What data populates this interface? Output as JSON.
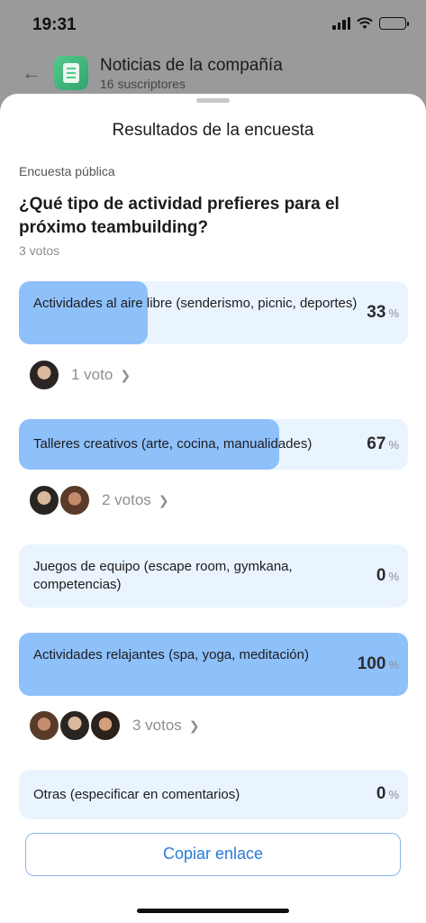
{
  "status_bar": {
    "time": "19:31"
  },
  "chat_header": {
    "title": "Noticias de la compañía",
    "subtitle": "16 suscriptores"
  },
  "sheet": {
    "title": "Resultados de la encuesta",
    "poll_type": "Encuesta pública",
    "question": "¿Qué tipo de actividad prefieres para el próximo teambuilding?",
    "total_votes": "3 votos",
    "copy_link": "Copiar enlace"
  },
  "options": [
    {
      "label": "Actividades al aire libre (senderismo, picnic, deportes)",
      "percent": "33",
      "fill": 0.33,
      "voters": "1 voto",
      "avatars": 1
    },
    {
      "label": "Talleres creativos (arte, cocina, manualidades)",
      "percent": "67",
      "fill": 0.67,
      "voters": "2 votos",
      "avatars": 2
    },
    {
      "label": "Juegos de equipo (escape room, gymkana, competencias)",
      "percent": "0",
      "fill": 0,
      "voters": "",
      "avatars": 0
    },
    {
      "label": "Actividades relajantes (spa, yoga, meditación)",
      "percent": "100",
      "fill": 1.0,
      "voters": "3 votos",
      "avatars": 3
    },
    {
      "label": "Otras (especificar en comentarios)",
      "percent": "0",
      "fill": 0,
      "voters": "",
      "avatars": 0
    }
  ],
  "percent_sign": "%",
  "colors": {
    "accent": "#2b7ad6",
    "fill": "#8ec0fa",
    "track": "#eaf4ff"
  },
  "icons": {
    "back": "back-arrow-icon",
    "chevron": "chevron-right-icon"
  }
}
